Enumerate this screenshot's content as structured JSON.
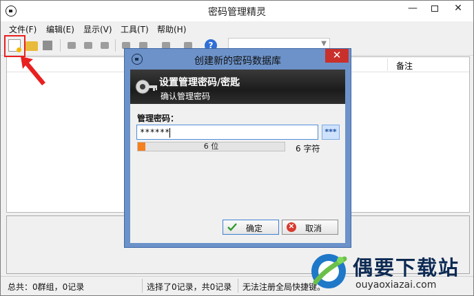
{
  "window": {
    "title": "密码管理精灵",
    "minimize_glyph": "—",
    "close_glyph": "✕"
  },
  "menu": [
    {
      "label": "文件(F)"
    },
    {
      "label": "编辑(E)"
    },
    {
      "label": "显示(V)"
    },
    {
      "label": "工具(T)"
    },
    {
      "label": "帮助(H)"
    }
  ],
  "toolbar": {
    "help_glyph": "?",
    "combo_arrow": "▼"
  },
  "list": {
    "columns": [
      "备注"
    ]
  },
  "status": {
    "summary": "总共：0群组，0记录",
    "selection": "选择了0记录，共0记录",
    "hotkey": "无法注册全局快捷键。"
  },
  "dialog": {
    "title": "创建新的密码数据库",
    "close_glyph": "✕",
    "banner_title": "设置管理密码/密匙",
    "banner_subtitle": "确认管理密码",
    "password_label": "管理密码：",
    "password_value": "******",
    "toggle_label": "***",
    "strength_fraction": 0.05,
    "strength_text": "6 位",
    "char_count": "6 字符",
    "ok_label": "确定",
    "cancel_label": "取消",
    "cancel_glyph": "✕"
  },
  "watermark": {
    "title": "偶要下载站",
    "url": "ouyaoxiazai.com"
  },
  "colors": {
    "highlight": "#e8201f",
    "dialog_frame": "#6c92c9",
    "close_button": "#c9302c",
    "strength": "#f4801f"
  }
}
